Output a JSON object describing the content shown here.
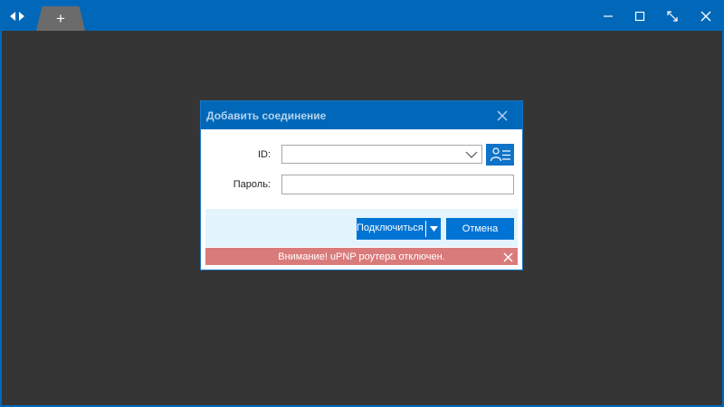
{
  "window": {
    "tab_add_symbol": "+",
    "icons": {
      "nav": "left-right-arrows-icon",
      "add": "plus-icon",
      "minimize": "minimize-icon",
      "maximize": "maximize-icon",
      "fullscreen": "diagonal-arrows-icon",
      "close": "close-icon"
    },
    "colors": {
      "titlebar": "#0168b9",
      "workspace": "#353535"
    }
  },
  "dialog": {
    "title": "Добавить соединение",
    "id_label": "ID:",
    "id_value": "",
    "password_label": "Пароль:",
    "password_value": "",
    "connect_label": "Подключиться",
    "cancel_label": "Отмена",
    "warning": "Внимание! uPNP роутера отключен.",
    "colors": {
      "header": "#0168b9",
      "button": "#0074d4",
      "footer": "#e3f4fc",
      "warning": "#da7b7b"
    }
  }
}
